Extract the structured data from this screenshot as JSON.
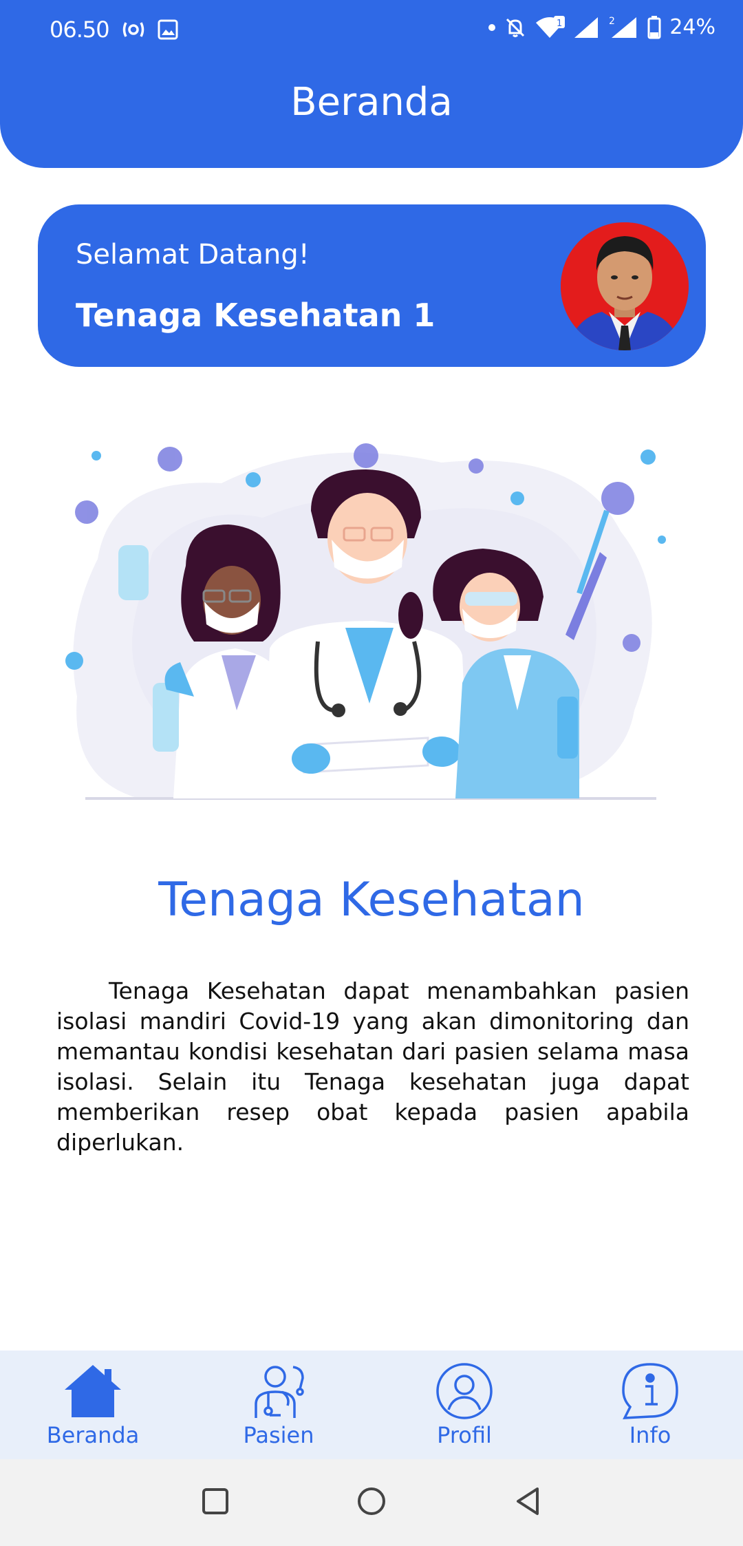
{
  "status_bar": {
    "time": "06.50",
    "battery": "24%",
    "icons": [
      "radio-icon",
      "image-icon",
      "dot-icon",
      "bell-off-icon",
      "wifi-icon",
      "signal-icon",
      "signal-icon",
      "battery-icon"
    ]
  },
  "header": {
    "title": "Beranda"
  },
  "welcome": {
    "greeting": "Selamat Datang!",
    "name": "Tenaga Kesehatan 1"
  },
  "section": {
    "title": "Tenaga Kesehatan",
    "description": "Tenaga Kesehatan dapat menambahkan pasien isolasi mandiri Covid-19 yang akan dimonitoring dan memantau kondisi kesehatan dari pasien selama masa isolasi. Selain itu Tenaga kesehatan juga dapat memberikan resep obat kepada pasien apabila diperlukan."
  },
  "bottom_nav": {
    "items": [
      {
        "label": "Beranda",
        "icon": "home-icon"
      },
      {
        "label": "Pasien",
        "icon": "doctor-icon"
      },
      {
        "label": "Profil",
        "icon": "user-icon"
      },
      {
        "label": "Info",
        "icon": "info-icon"
      }
    ]
  },
  "colors": {
    "primary": "#2f69e6",
    "nav_bg": "#e8effa",
    "avatar_bg": "#e31c1c"
  }
}
